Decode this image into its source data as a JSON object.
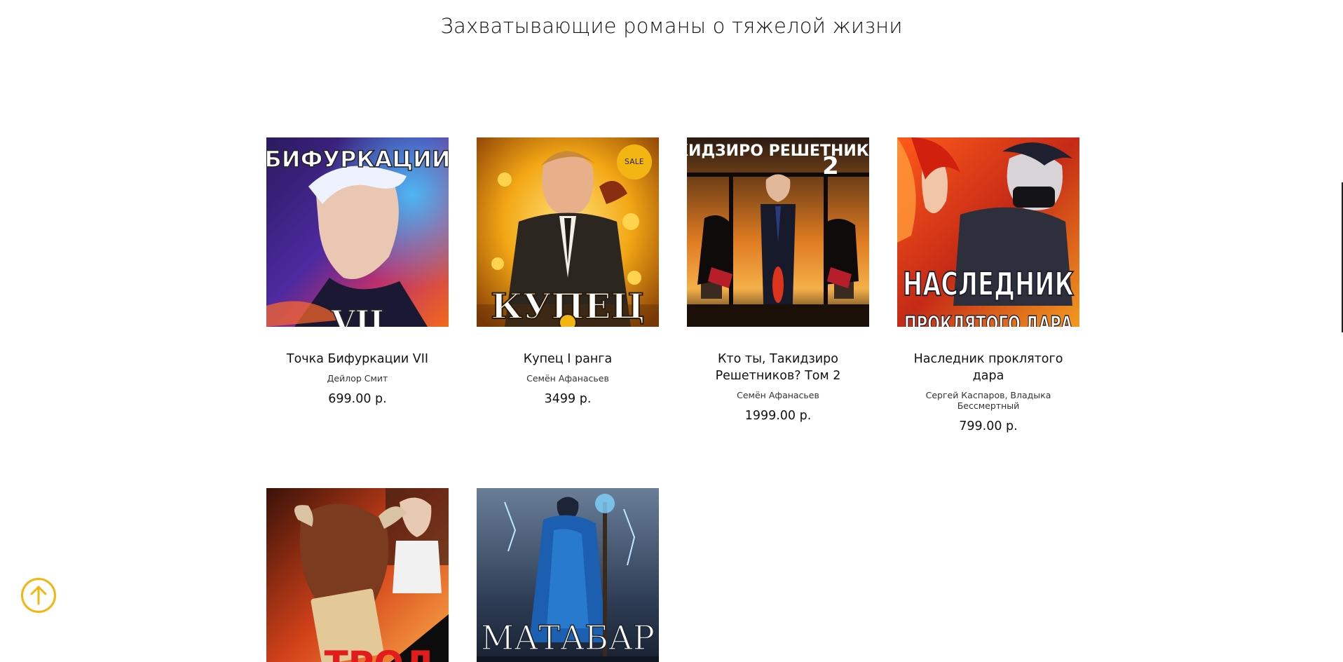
{
  "section": {
    "title": "Захватывающие романы о тяжелой жизни"
  },
  "products": [
    {
      "title": "Точка Бифуркации VII",
      "author": "Дейлор Смит",
      "price": "699.00 р.",
      "cover_text_top": "БИФУРКАЦИИ",
      "cover_text_bottom": "VII"
    },
    {
      "title": "Купец I ранга",
      "author": "Семён Афанасьев",
      "price": "3499 р.",
      "badge": "SALE",
      "cover_text_bottom": "КУПЕЦ"
    },
    {
      "title": "Кто ты, Такидзиро Решетников? Том 2",
      "author": "Семён Афанасьев",
      "price": "1999.00 р.",
      "cover_text_top": "ТАКИДЗИРО РЕШЕТНИКОВ?",
      "cover_number": "2"
    },
    {
      "title": "Наследник проклятого дара",
      "author": "Сергей Каспаров, Владыка Бессмертный",
      "price": "799.00 р.",
      "cover_text_bottom": "НАСЛЕДНИК",
      "cover_text_bottom2": "ПРОКЛЯТОГО ДАРА"
    },
    {
      "title": "",
      "author": "",
      "price": "",
      "cover_text_bottom": "ТРОЛ"
    },
    {
      "title": "",
      "author": "",
      "price": "",
      "cover_text_bottom": "МАТАБАР"
    }
  ],
  "scroll_top": {
    "icon": "arrow-up-circle-icon",
    "color": "#f2b512"
  },
  "colors": {
    "accent": "#f2b512",
    "text": "#111111"
  }
}
